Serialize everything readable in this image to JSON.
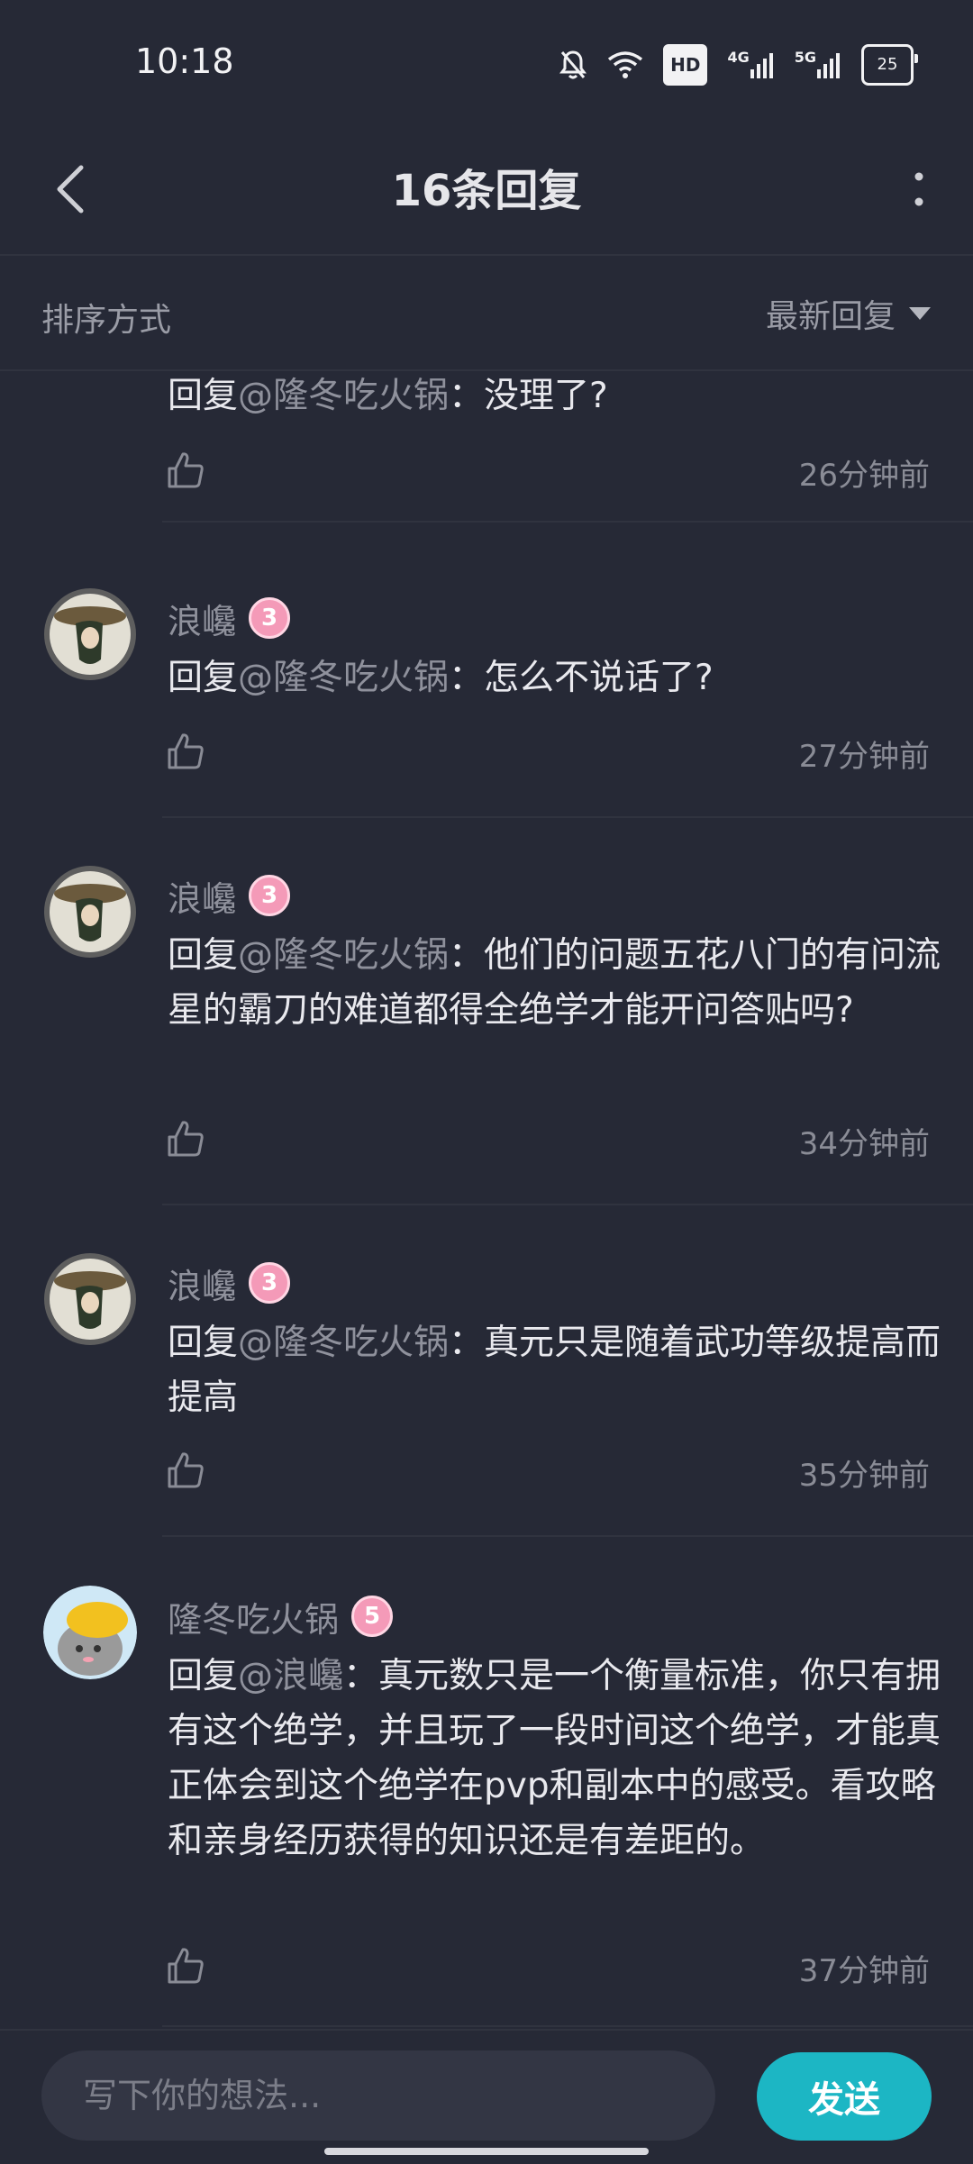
{
  "status_bar": {
    "time": "10:18",
    "hd_label": "HD",
    "network_4g": "4G",
    "network_5g": "5G",
    "battery": "25"
  },
  "header": {
    "title": "16条回复"
  },
  "sort_bar": {
    "label": "排序方式",
    "selected": "最新回复"
  },
  "comments": [
    {
      "prefix": "回复",
      "mention": "@隆冬吃火锅",
      "separator": "：",
      "text": "没理了?",
      "time": "26分钟前"
    },
    {
      "username": "浪巉",
      "level": "3",
      "prefix": "回复",
      "mention": "@隆冬吃火锅",
      "separator": "：",
      "text": "怎么不说话了?",
      "time": "27分钟前"
    },
    {
      "username": "浪巉",
      "level": "3",
      "prefix": "回复",
      "mention": "@隆冬吃火锅",
      "separator": "：",
      "text": "他们的问题五花八门的有问流星的霸刀的难道都得全绝学才能开问答贴吗?",
      "time": "34分钟前"
    },
    {
      "username": "浪巉",
      "level": "3",
      "prefix": "回复",
      "mention": "@隆冬吃火锅",
      "separator": "：",
      "text": "真元只是随着武功等级提高而提高",
      "time": "35分钟前"
    },
    {
      "username": "隆冬吃火锅",
      "level": "5",
      "prefix": "回复",
      "mention": "@浪巉",
      "separator": "：",
      "text": "真元数只是一个衡量标准，你只有拥有这个绝学，并且玩了一段时间这个绝学，才能真正体会到这个绝学在pvp和副本中的感受。看攻略和亲身经历获得的知识还是有差距的。",
      "time": "37分钟前"
    }
  ],
  "input_bar": {
    "placeholder": "写下你的想法...",
    "send_label": "发送"
  },
  "colors": {
    "background": "#262936",
    "accent": "#1cb6c4",
    "level_badge": "#f49ab8"
  },
  "icons": {
    "back": "chevron-left-icon",
    "more": "more-vertical-icon",
    "sort": "caret-down-icon",
    "like": "thumbs-up-icon",
    "mute": "bell-off-icon",
    "wifi": "wifi-icon",
    "signal": "signal-icon"
  }
}
